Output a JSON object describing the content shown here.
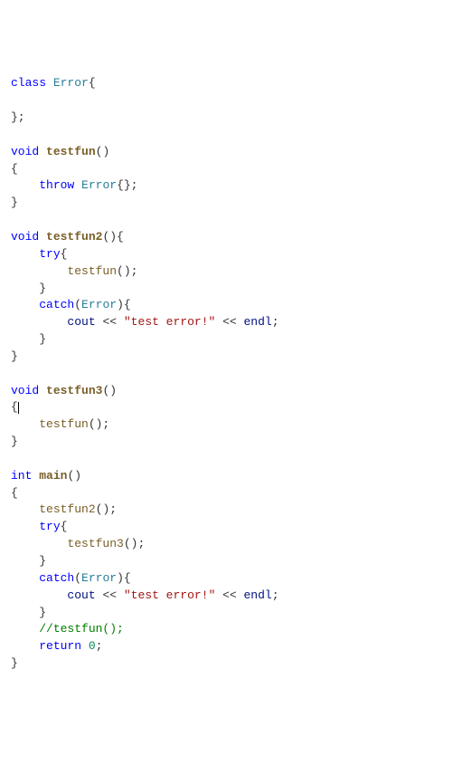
{
  "code": {
    "class_kw": "class",
    "error_type": "Error",
    "void_kw": "void",
    "int_kw": "int",
    "throw_kw": "throw",
    "try_kw": "try",
    "catch_kw": "catch",
    "return_kw": "return",
    "testfun": "testfun",
    "testfun2": "testfun2",
    "testfun3": "testfun3",
    "main_fn": "main",
    "cout": "cout",
    "endl": "endl",
    "str_lit": "\"test error!\"",
    "zero": "0",
    "comment": "//testfun();"
  }
}
